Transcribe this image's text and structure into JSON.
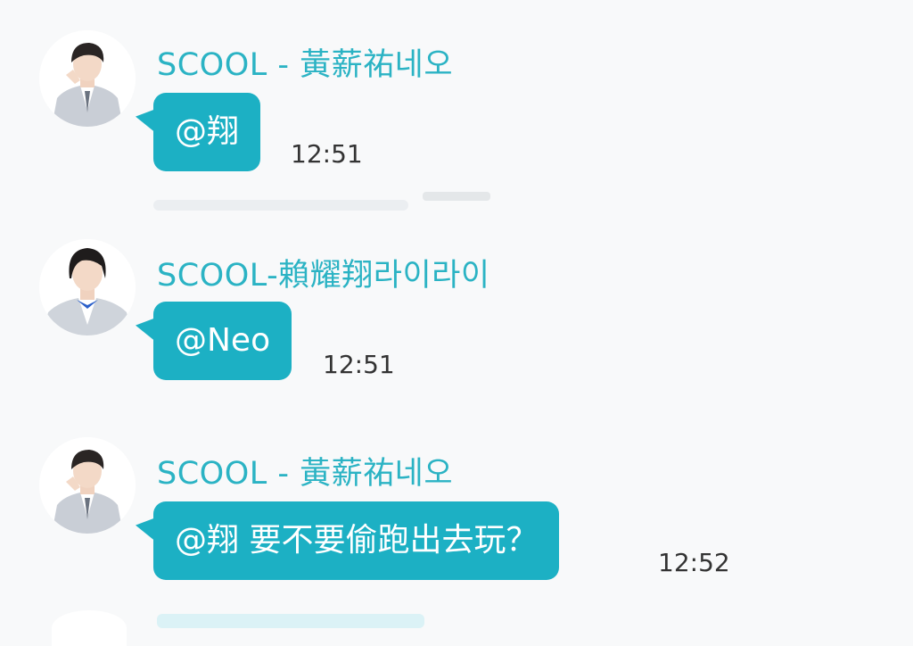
{
  "messages": [
    {
      "sender": "SCOOL - 黃薪祐네오",
      "text": "@翔",
      "time": "12:51"
    },
    {
      "sender": "SCOOL-賴耀翔라이라이",
      "text": "@Neo",
      "time": "12:51"
    },
    {
      "sender": "SCOOL - 黃薪祐네오",
      "text": "@翔 要不要偷跑出去玩？",
      "time": "12:52"
    }
  ],
  "colors": {
    "accent": "#1cb0c4",
    "name": "#2bb3c4",
    "background": "#f8f9fa"
  }
}
